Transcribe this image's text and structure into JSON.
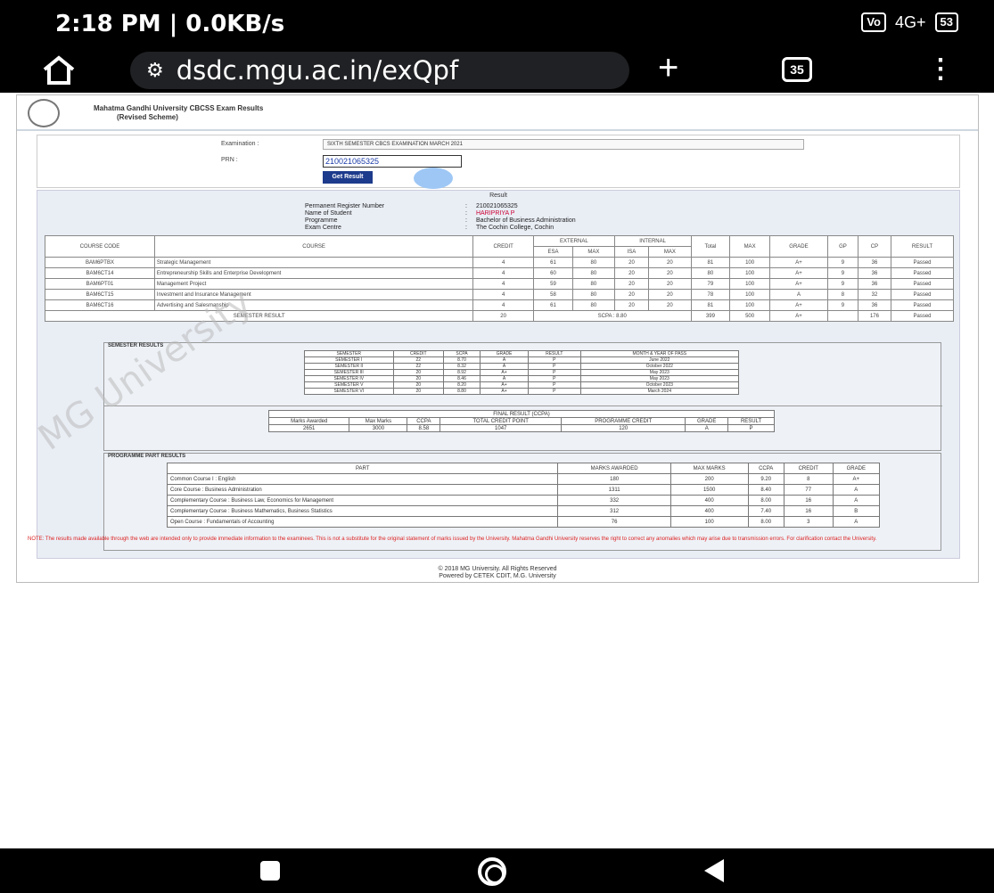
{
  "status_bar": {
    "time": "2:18 PM | 0.0KB/s",
    "volte": "Vo",
    "network": "4G+",
    "battery": "53"
  },
  "browser": {
    "url": "dsdc.mgu.ac.in/exQpf",
    "tab_count": "35"
  },
  "page": {
    "header_title": "Mahatma Gandhi University CBCSS Exam Results",
    "header_subtitle": "(Revised Scheme)",
    "exam_label": "Examination :",
    "exam_value": "SIXTH SEMESTER CBCS EXAMINATION MARCH 2021",
    "prn_label": "PRN :",
    "prn_value": "210021065325",
    "submit_label": "Get Result",
    "result_caption": "Result",
    "info": [
      {
        "key": "Permanent Register Number",
        "value": "210021065325"
      },
      {
        "key": "Name of Student",
        "value": "HARIPRIYA P"
      },
      {
        "key": "Programme",
        "value": "Bachelor of Business Administration"
      },
      {
        "key": "Exam Centre",
        "value": "The Cochin College, Cochin"
      }
    ],
    "marks_header": {
      "code": "COURSE CODE",
      "course": "COURSE",
      "credit": "CREDIT",
      "external": "EXTERNAL",
      "internal": "INTERNAL",
      "ext_isa": "ESA",
      "ext_max": "MAX",
      "int_isa": "ISA",
      "int_max": "MAX",
      "total": "Total",
      "max": "MAX",
      "grade": "GRADE",
      "gp": "GP",
      "cp": "CP",
      "result": "RESULT"
    },
    "marks_rows": [
      {
        "code": "BAM6PTBX",
        "course": "Strategic Management",
        "credit": "4",
        "e1": "61",
        "e2": "80",
        "i1": "20",
        "i2": "20",
        "total": "81",
        "max": "100",
        "grade": "A+",
        "gp": "9",
        "cp": "36",
        "result": "Passed"
      },
      {
        "code": "BAM6CT14",
        "course": "Entrepreneurship Skills and Enterprise Development",
        "credit": "4",
        "e1": "60",
        "e2": "80",
        "i1": "20",
        "i2": "20",
        "total": "80",
        "max": "100",
        "grade": "A+",
        "gp": "9",
        "cp": "36",
        "result": "Passed"
      },
      {
        "code": "BAM6PT01",
        "course": "Management Project",
        "credit": "4",
        "e1": "59",
        "e2": "80",
        "i1": "20",
        "i2": "20",
        "total": "79",
        "max": "100",
        "grade": "A+",
        "gp": "9",
        "cp": "36",
        "result": "Passed"
      },
      {
        "code": "BAM6CT15",
        "course": "Investment and Insurance Management",
        "credit": "4",
        "e1": "58",
        "e2": "80",
        "i1": "20",
        "i2": "20",
        "total": "78",
        "max": "100",
        "grade": "A",
        "gp": "8",
        "cp": "32",
        "result": "Passed"
      },
      {
        "code": "BAM6CT16",
        "course": "Advertising and Salesmanship",
        "credit": "4",
        "e1": "61",
        "e2": "80",
        "i1": "20",
        "i2": "20",
        "total": "81",
        "max": "100",
        "grade": "A+",
        "gp": "9",
        "cp": "36",
        "result": "Passed"
      }
    ],
    "semester_total": {
      "label": "SEMESTER RESULT",
      "credit": "20",
      "scpa": "SCPA : 8.80",
      "total": "399",
      "max": "500",
      "grade": "A+",
      "cp": "176",
      "result": "Passed"
    },
    "sem_caption": "SEMESTER RESULTS",
    "sem_header": [
      "SEMESTER",
      "CREDIT",
      "SCPA",
      "GRADE",
      "RESULT",
      "MONTH & YEAR OF PASS"
    ],
    "sem_rows": [
      [
        "SEMESTER I",
        "22",
        "8.70",
        "A",
        "P",
        "June 2022"
      ],
      [
        "SEMESTER II",
        "22",
        "8.32",
        "A",
        "P",
        "October 2022"
      ],
      [
        "SEMESTER III",
        "20",
        "8.92",
        "A+",
        "P",
        "May 2023"
      ],
      [
        "SEMESTER IV",
        "20",
        "8.46",
        "A",
        "P",
        "May 2023"
      ],
      [
        "SEMESTER V",
        "20",
        "8.20",
        "A+",
        "P",
        "October 2023"
      ],
      [
        "SEMESTER VI",
        "20",
        "8.80",
        "A+",
        "P",
        "March 2024"
      ]
    ],
    "final_caption": "FINAL RESULT (CCPA)",
    "final_header": [
      "Marks Awarded",
      "Max Marks",
      "CCPA",
      "TOTAL CREDIT POINT",
      "PROGRAMME CREDIT",
      "GRADE",
      "RESULT"
    ],
    "final_row": [
      "2651",
      "3000",
      "8.58",
      "1047",
      "120",
      "A",
      "P"
    ],
    "prog_caption": "PROGRAMME PART RESULTS",
    "prog_header": [
      "PART",
      "MARKS AWARDED",
      "MAX MARKS",
      "CCPA",
      "CREDIT",
      "GRADE"
    ],
    "prog_rows": [
      [
        "Common Course I : English",
        "180",
        "200",
        "9.20",
        "8",
        "A+"
      ],
      [
        "Core Course : Business Administration",
        "1311",
        "1500",
        "8.40",
        "77",
        "A"
      ],
      [
        "Complementary Course : Business Law, Economics for Management",
        "332",
        "400",
        "8.00",
        "16",
        "A"
      ],
      [
        "Complementary Course : Business Mathematics, Business Statistics",
        "312",
        "400",
        "7.40",
        "16",
        "B"
      ],
      [
        "Open Course : Fundamentals of Accounting",
        "76",
        "100",
        "8.00",
        "3",
        "A"
      ]
    ],
    "watermark": "MG University",
    "note": "NOTE: The results made available through the web are intended only to provide immediate information to the examinees. This is not a substitute for the original statement of marks issued by the University. Mahatma Gandhi University reserves the right to correct any anomalies which may arise due to transmission errors. For clarification contact the University.",
    "footer_line1": "© 2018 MG University. All Rights Reserved",
    "footer_line2": "Powered by CETEK CDIT, M.G. University"
  }
}
